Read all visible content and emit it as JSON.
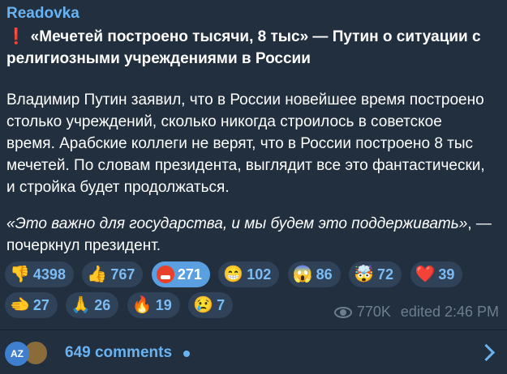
{
  "channel": "Readovka",
  "headline": {
    "icon": "exclamation-icon",
    "text": "«Мечетей построено тысячи, 8 тыс» — Путин о ситуации с религиозными учреждениями в России"
  },
  "body": "Владимир Путин заявил, что в России новейшее время построено столько учреждений, сколько никогда строилось в советское время. Арабские коллеги не верят, что в России построено 8 тыс мечетей. По словам президента, выглядит все это фантастически, и стройка будет продолжаться.",
  "quote": {
    "italic": "«Это важно для государства, и мы будем это поддерживать»",
    "rest": ", — почеркнул президент."
  },
  "reactions": [
    {
      "icon": "thumbs-down-icon",
      "emoji": "👎",
      "count": "4398"
    },
    {
      "icon": "thumbs-up-icon",
      "emoji": "👍",
      "count": "767"
    },
    {
      "icon": "angry-face-icon",
      "emoji": "",
      "count": "271",
      "active": true
    },
    {
      "icon": "grinning-face-icon",
      "emoji": "😁",
      "count": "102"
    },
    {
      "icon": "screaming-face-icon",
      "emoji": "😱",
      "count": "86"
    },
    {
      "icon": "exploding-head-icon",
      "emoji": "🤯",
      "count": "72"
    },
    {
      "icon": "heart-icon",
      "emoji": "❤️",
      "count": "39"
    },
    {
      "icon": "pointing-hand-icon",
      "emoji": "🫲",
      "count": "27"
    },
    {
      "icon": "praying-hands-icon",
      "emoji": "🙏",
      "count": "26"
    },
    {
      "icon": "fire-icon",
      "emoji": "🔥",
      "count": "19"
    },
    {
      "icon": "crying-face-icon",
      "emoji": "😢",
      "count": "7"
    }
  ],
  "meta": {
    "views": "770K",
    "edited": "edited 2:46 PM"
  },
  "comments": {
    "avatar_initials": "AZ",
    "label": "649 comments"
  }
}
